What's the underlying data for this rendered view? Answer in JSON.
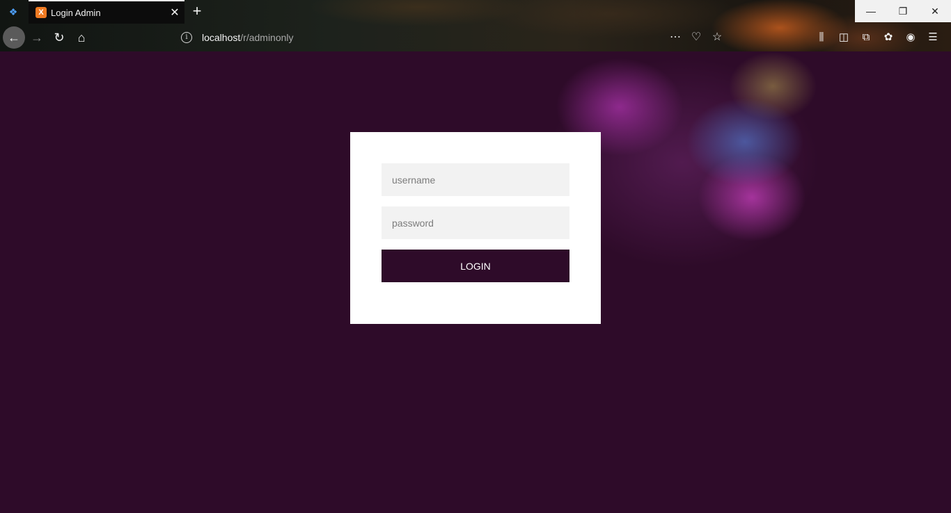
{
  "browser": {
    "tab": {
      "title": "Login Admin",
      "favicon": "X"
    },
    "new_tab_label": "+",
    "url": {
      "host": "localhost",
      "path": "/r/adminonly"
    },
    "window_controls": {
      "minimize": "—",
      "restore": "❐",
      "close": "✕"
    }
  },
  "login": {
    "username_placeholder": "username",
    "password_placeholder": "password",
    "button_label": "LOGIN"
  },
  "colors": {
    "page_background": "#2e0b29",
    "card_background": "#ffffff",
    "button_background": "#2e0b29",
    "field_background": "#f2f2f2"
  }
}
